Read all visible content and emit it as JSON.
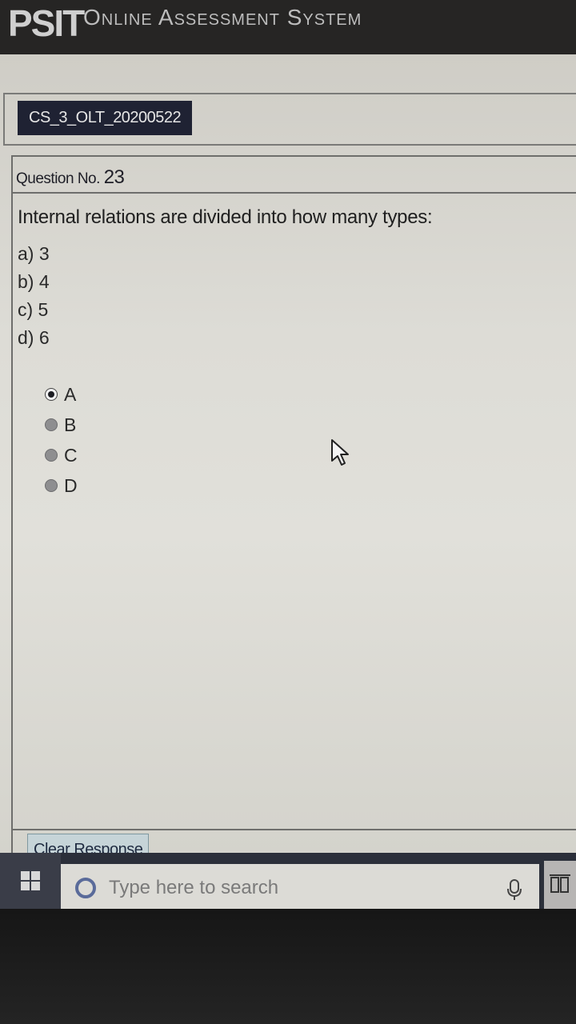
{
  "header": {
    "brand": "PSIT",
    "system_title": "Online Assessment System"
  },
  "test": {
    "id": "CS_3_OLT_20200522"
  },
  "question": {
    "number_label": "Question No.",
    "number": "23",
    "text": "Internal relations are divided into how many types:",
    "choices": [
      "a) 3",
      "b) 4",
      "c) 5",
      "d)  6"
    ]
  },
  "options": [
    {
      "label": "A",
      "selected": true
    },
    {
      "label": "B",
      "selected": false
    },
    {
      "label": "C",
      "selected": false
    },
    {
      "label": "D",
      "selected": false
    }
  ],
  "actions": {
    "clear_response": "Clear Response"
  },
  "taskbar": {
    "search_placeholder": "Type here to search"
  },
  "colors": {
    "header_bg": "#262524",
    "test_id_bg": "#1f2233",
    "page_bg": "#dddcd6",
    "clear_button_bg": "#c6d4d8",
    "taskbar_bg": "#2b2f3a"
  },
  "icons": [
    "windows-logo-icon",
    "search-circle-icon",
    "microphone-icon",
    "task-view-icon",
    "mouse-cursor-icon"
  ]
}
